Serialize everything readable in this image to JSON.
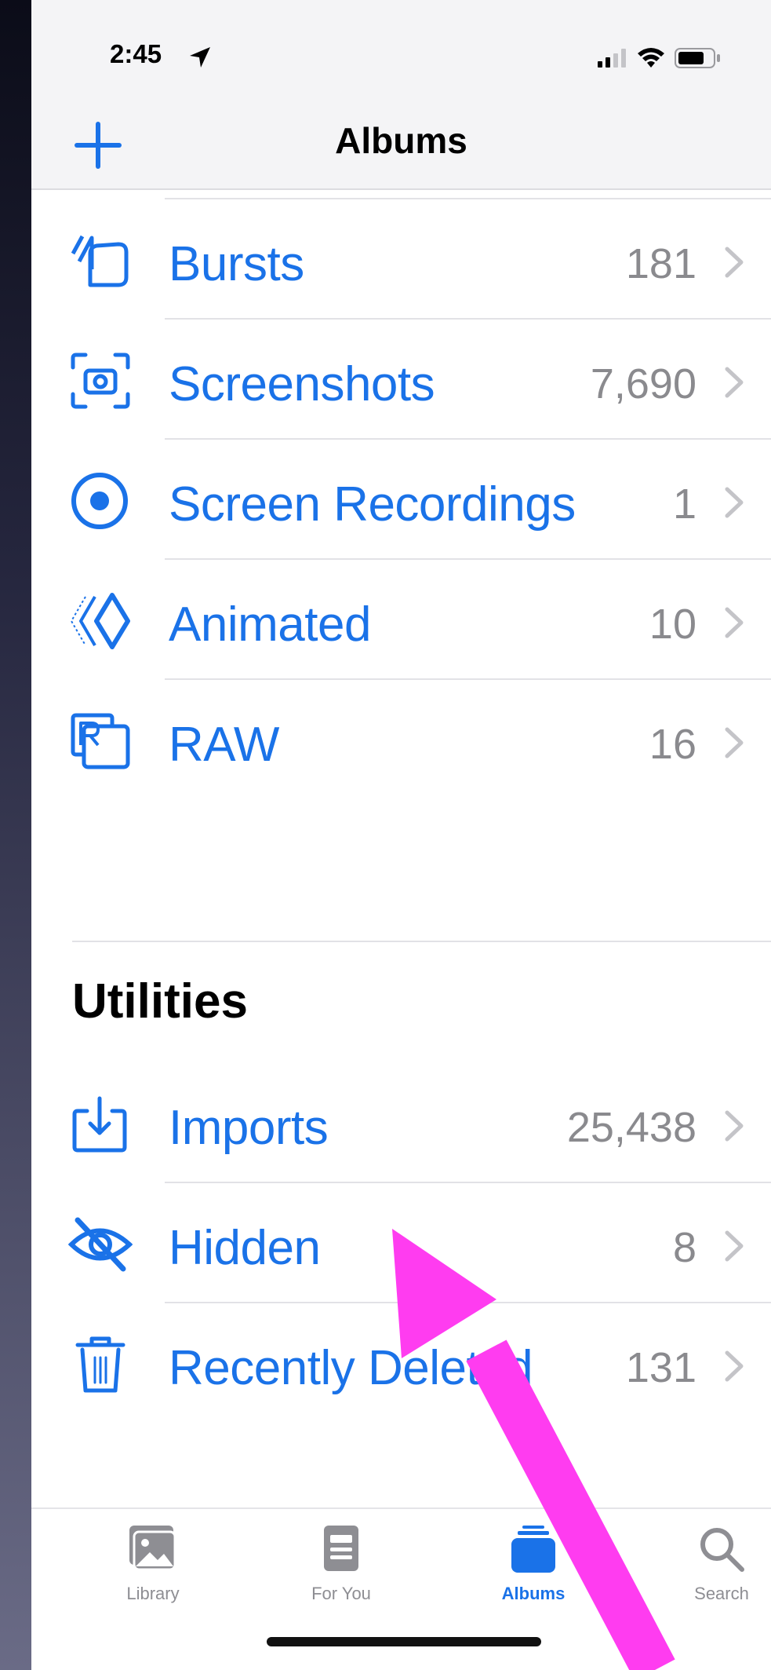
{
  "status_bar": {
    "time": "2:45"
  },
  "nav": {
    "title": "Albums",
    "add_icon": "plus-icon"
  },
  "media_types": [
    {
      "label": "Bursts",
      "count": "181",
      "icon": "bursts-icon"
    },
    {
      "label": "Screenshots",
      "count": "7,690",
      "icon": "screenshot-icon"
    },
    {
      "label": "Screen Recordings",
      "count": "1",
      "icon": "screen-recording-icon"
    },
    {
      "label": "Animated",
      "count": "10",
      "icon": "animated-icon"
    },
    {
      "label": "RAW",
      "count": "16",
      "icon": "raw-icon"
    }
  ],
  "utilities": {
    "title": "Utilities",
    "items": [
      {
        "label": "Imports",
        "count": "25,438",
        "icon": "import-icon"
      },
      {
        "label": "Hidden",
        "count": "8",
        "icon": "eye-slash-icon"
      },
      {
        "label": "Recently Deleted",
        "count": "131",
        "icon": "trash-icon"
      }
    ]
  },
  "tab_bar": {
    "tabs": [
      {
        "label": "Library",
        "icon": "photo-library-icon",
        "active": false
      },
      {
        "label": "For You",
        "icon": "for-you-icon",
        "active": false
      },
      {
        "label": "Albums",
        "icon": "albums-icon",
        "active": true
      },
      {
        "label": "Search",
        "icon": "search-icon",
        "active": false
      }
    ]
  },
  "colors": {
    "accent": "#1a72e8",
    "count_gray": "#8a8a8e",
    "annotation_arrow": "#ff3cf0"
  }
}
